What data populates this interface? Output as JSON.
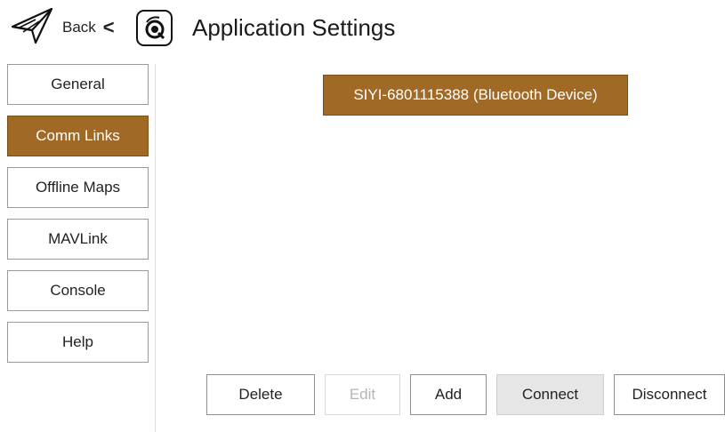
{
  "header": {
    "back_label": "Back",
    "back_caret": "<",
    "title": "Application Settings",
    "back_icon": "paper-plane-icon",
    "logo_icon": "qgc-logo-icon"
  },
  "sidebar": {
    "items": [
      {
        "label": "General",
        "active": false
      },
      {
        "label": "Comm Links",
        "active": true
      },
      {
        "label": "Offline Maps",
        "active": false
      },
      {
        "label": "MAVLink",
        "active": false
      },
      {
        "label": "Console",
        "active": false
      },
      {
        "label": "Help",
        "active": false
      }
    ]
  },
  "links": {
    "items": [
      {
        "label": "SIYI-6801115388 (Bluetooth Device)",
        "selected": true
      }
    ]
  },
  "actions": {
    "delete": "Delete",
    "edit": "Edit",
    "add": "Add",
    "connect": "Connect",
    "disconnect": "Disconnect"
  },
  "colors": {
    "accent": "#a06a26",
    "disabled_text": "#b5b5b5",
    "pressed_bg": "#e6e6e6"
  }
}
